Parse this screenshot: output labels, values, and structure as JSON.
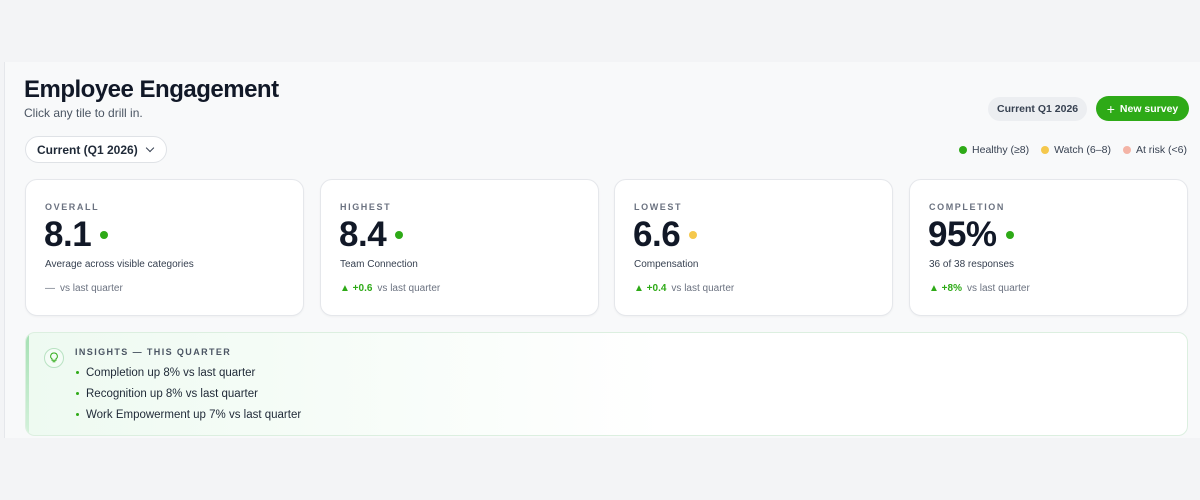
{
  "header": {
    "title": "Employee Engagement",
    "subtitle": "Click any tile to drill in.",
    "period_badge": "Current Q1 2026",
    "new_survey_label": "New survey"
  },
  "filter": {
    "selected": "Current (Q1 2026)"
  },
  "legend": [
    {
      "label": "Healthy (≥8)",
      "color": "#2eaa17"
    },
    {
      "label": "Watch (6–8)",
      "color": "#f5c84c"
    },
    {
      "label": "At risk (<6)",
      "color": "#f4b4a6"
    }
  ],
  "colors": {
    "accent": "#2eaa17",
    "healthy": "#2eaa17",
    "watch": "#f5c84c",
    "at_risk": "#f4b4a6"
  },
  "cards": [
    {
      "label": "OVERALL",
      "value": "8.1",
      "status": "healthy",
      "sub": "Average across visible categories",
      "delta": "—",
      "delta_suffix": "vs last quarter"
    },
    {
      "label": "HIGHEST",
      "value": "8.4",
      "status": "healthy",
      "sub": "Team Connection",
      "delta": "▲ +0.6",
      "delta_suffix": "vs last quarter"
    },
    {
      "label": "LOWEST",
      "value": "6.6",
      "status": "watch",
      "sub": "Compensation",
      "delta": "▲ +0.4",
      "delta_suffix": "vs last quarter"
    },
    {
      "label": "COMPLETION",
      "value": "95%",
      "status": "healthy",
      "sub": "36 of 38 responses",
      "delta": "▲ +8%",
      "delta_suffix": "vs last quarter"
    }
  ],
  "insights": {
    "heading": "INSIGHTS — THIS QUARTER",
    "icon": "lightbulb-icon",
    "items": [
      "Completion up 8% vs last quarter",
      "Recognition up 8% vs last quarter",
      "Work Empowerment up 7% vs last quarter"
    ]
  }
}
